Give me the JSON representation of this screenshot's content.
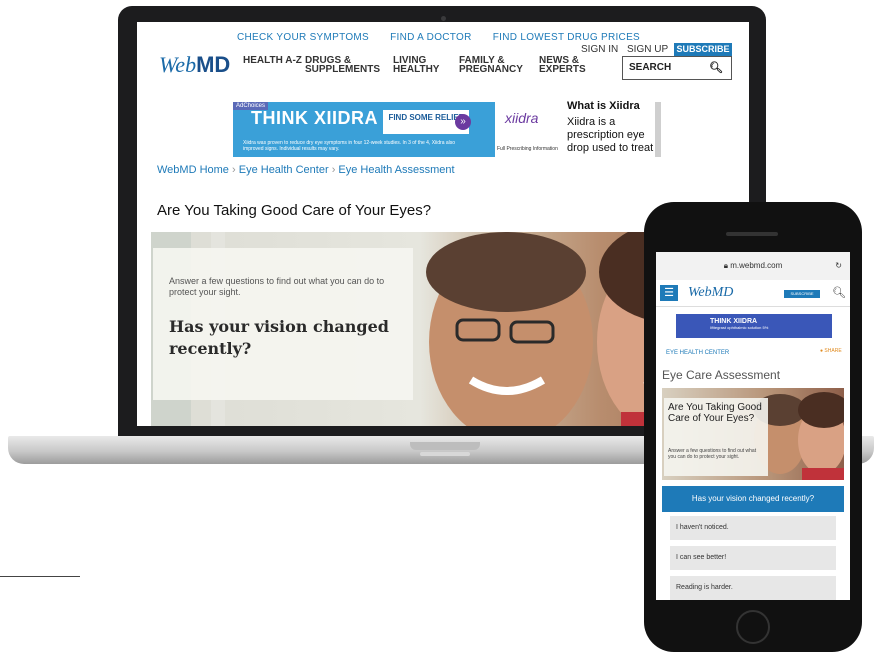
{
  "desktop": {
    "topnav": [
      "CHECK YOUR SYMPTOMS",
      "FIND A DOCTOR",
      "FIND LOWEST DRUG PRICES"
    ],
    "logo": {
      "web": "Web",
      "md": "MD"
    },
    "categories": [
      "HEALTH A-Z",
      "DRUGS & SUPPLEMENTS",
      "LIVING HEALTHY",
      "FAMILY & PREGNANCY",
      "NEWS & EXPERTS"
    ],
    "sign_in": "SIGN IN",
    "sign_up": "SIGN UP",
    "subscribe": "SUBSCRIBE",
    "search_label": "SEARCH",
    "ad": {
      "tag": "AdChoices",
      "headline": "THINK XIIDRA",
      "find_button": "FIND SOME RELIEF",
      "fine_print": "Xiidra was proven to reduce dry eye symptoms in four 12-week studies. In 3 of the 4, Xiidra also improved signs. Individual results may vary.",
      "brand": "xiidra",
      "pfi": "Full Prescribing Information",
      "side_title": "What is Xiidra",
      "side_text": "Xiidra is a prescription eye drop used to treat"
    },
    "breadcrumb": [
      "WebMD Home",
      "Eye Health Center",
      "Eye Health Assessment"
    ],
    "page_title": "Are You Taking Good Care of Your Eyes?",
    "hero_intro": "Answer a few questions to find out what you can do to protect your sight.",
    "hero_question": "Has your vision changed recently?"
  },
  "mobile": {
    "url": "m.webmd.com",
    "logo": "WebMD",
    "subscribe": "SUBSCRIBE",
    "ad_headline": "THINK XIIDRA",
    "ad_sub": "lifitegrast ophthalmic solution 5%",
    "section": "EYE HEALTH CENTER",
    "share": "SHARE",
    "title": "Eye Care Assessment",
    "hero_heading": "Are You Taking Good Care of Your Eyes?",
    "hero_intro": "Answer a few questions to find out what you can do to protect your sight.",
    "question": "Has your vision changed recently?",
    "options": [
      "I haven't noticed.",
      "I can see better!",
      "Reading is harder."
    ]
  }
}
